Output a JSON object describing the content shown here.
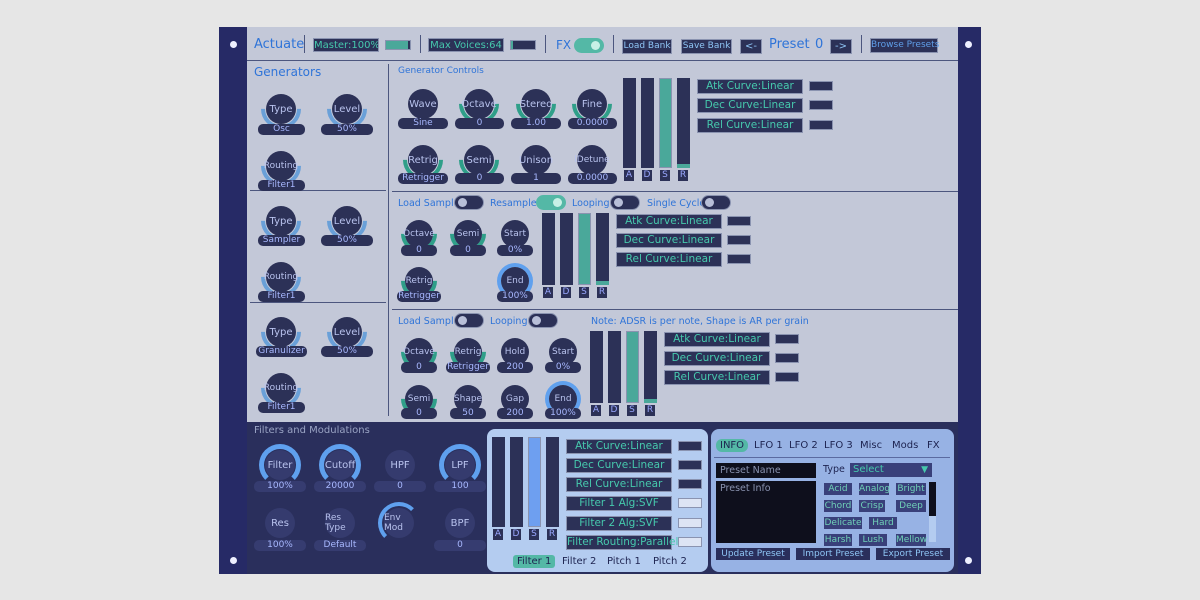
{
  "colors": {
    "frame": "#262a66",
    "panel": "#c3c8d8",
    "teal": "#54b8a6",
    "accent_blue": "#2f74d8",
    "dark": "#2c3157"
  },
  "topbar": {
    "app_name": "Actuate",
    "master": "Master:100%",
    "master_level": 0.9,
    "max_voices": "Max Voices:64",
    "max_voices_level": 0.1,
    "fx_label": "FX",
    "load_bank": "Load Bank",
    "save_bank": "Save Bank",
    "prev": "<-",
    "preset_label": "Preset",
    "preset_number": "0",
    "next": "->",
    "browse": "Browse Presets"
  },
  "generators": {
    "title": "Generators",
    "controls_title": "Generator Controls",
    "rows": [
      {
        "type_label": "Type",
        "type_value": "Osc",
        "level_label": "Level",
        "level_value": "50%",
        "routing_label": "Routing",
        "routing_value": "Filter1"
      },
      {
        "type_label": "Type",
        "type_value": "Sampler",
        "level_label": "Level",
        "level_value": "50%",
        "routing_label": "Routing",
        "routing_value": "Filter1"
      },
      {
        "type_label": "Type",
        "type_value": "Granulizer",
        "level_label": "Level",
        "level_value": "50%",
        "routing_label": "Routing",
        "routing_value": "Filter1"
      }
    ]
  },
  "osc": {
    "knobs": [
      {
        "label": "Wave",
        "value": "Sine"
      },
      {
        "label": "Octave",
        "value": "0"
      },
      {
        "label": "Stereo",
        "value": "1.00"
      },
      {
        "label": "Fine",
        "value": "0.0000"
      },
      {
        "label": "Retrig",
        "value": "Retrigger"
      },
      {
        "label": "Semi",
        "value": "0"
      },
      {
        "label": "Unison",
        "value": "1"
      },
      {
        "label": "lDetune",
        "value": "0.0000"
      }
    ],
    "adsr": {
      "labels": [
        "A",
        "D",
        "S",
        "R"
      ],
      "levels": [
        0,
        0,
        1,
        0.05
      ]
    },
    "curves": [
      "Atk Curve:Linear",
      "Dec Curve:Linear",
      "Rel Curve:Linear"
    ]
  },
  "sampler": {
    "load_sample": "Load Sample",
    "resample": "Resample",
    "looping": "Looping",
    "single_cycle": "Single Cycle",
    "resample_on": true,
    "knobs": [
      {
        "label": "Octave",
        "value": "0"
      },
      {
        "label": "Semi",
        "value": "0"
      },
      {
        "label": "Start",
        "value": "0%"
      },
      {
        "label": "Retrig",
        "value": "Retrigger"
      },
      {
        "label": "End",
        "value": "100%"
      }
    ],
    "adsr": {
      "labels": [
        "A",
        "D",
        "S",
        "R"
      ],
      "levels": [
        0,
        0,
        1,
        0.05
      ]
    },
    "curves": [
      "Atk Curve:Linear",
      "Dec Curve:Linear",
      "Rel Curve:Linear"
    ]
  },
  "granular": {
    "load_sample": "Load Sample",
    "looping": "Looping",
    "note": "Note: ADSR is per note, Shape is AR per grain",
    "knobs": [
      {
        "label": "Octave",
        "value": "0"
      },
      {
        "label": "Retrig",
        "value": "Retrigger"
      },
      {
        "label": "Hold",
        "value": "200"
      },
      {
        "label": "Start",
        "value": "0%"
      },
      {
        "label": "Semi",
        "value": "0"
      },
      {
        "label": "Shape",
        "value": "50"
      },
      {
        "label": "Gap",
        "value": "200"
      },
      {
        "label": "End",
        "value": "100%"
      }
    ],
    "adsr": {
      "labels": [
        "A",
        "D",
        "S",
        "R"
      ],
      "levels": [
        0,
        0,
        1,
        0.05
      ]
    },
    "curves": [
      "Atk Curve:Linear",
      "Dec Curve:Linear",
      "Rel Curve:Linear"
    ]
  },
  "filters": {
    "title": "Filters and Modulations",
    "knobs": [
      {
        "label": "Filter",
        "value": "100%"
      },
      {
        "label": "Cutoff",
        "value": "20000"
      },
      {
        "label": "HPF",
        "value": "0"
      },
      {
        "label": "LPF",
        "value": "100"
      },
      {
        "label": "Res",
        "value": "100%"
      },
      {
        "label": "Res Type",
        "value": "Default"
      },
      {
        "label": "Env Mod",
        "value": ""
      },
      {
        "label": "BPF",
        "value": "0"
      }
    ],
    "adsr": {
      "labels": [
        "A",
        "D",
        "S",
        "R"
      ],
      "levels": [
        0,
        0,
        1,
        0
      ]
    },
    "curves": [
      "Atk Curve:Linear",
      "Dec Curve:Linear",
      "Rel Curve:Linear",
      "Filter 1 Alg:SVF",
      "Filter 2 Alg:SVF",
      "Filter Routing:Parallel"
    ],
    "tabs": [
      "Filter 1",
      "Filter 2",
      "Pitch 1",
      "Pitch 2"
    ]
  },
  "info": {
    "tabs": [
      "INFO",
      "LFO 1",
      "LFO 2",
      "LFO 3",
      "Misc",
      "Mods",
      "FX"
    ],
    "preset_name_placeholder": "Preset Name",
    "preset_info_placeholder": "Preset Info",
    "type_label": "Type",
    "type_select": "Select",
    "tags": [
      "Acid",
      "Analog",
      "Bright",
      "Chord",
      "Crisp",
      "Deep",
      "Delicate",
      "Hard",
      "Harsh",
      "Lush",
      "Mellow"
    ],
    "update": "Update Preset",
    "import": "Import Preset",
    "export": "Export Preset"
  }
}
